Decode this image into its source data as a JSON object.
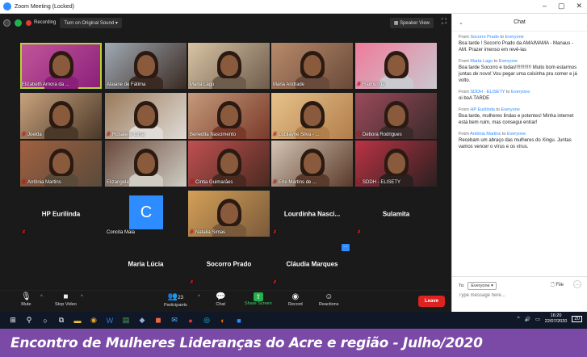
{
  "window": {
    "title": "Zoom Meeting (Locked)",
    "minimize": "–",
    "maximize": "▢",
    "close": "✕"
  },
  "topbar": {
    "recording": "Recording",
    "original_sound": "Turn on Original Sound",
    "original_sound_caret": "▾",
    "speaker_view": "Speaker View",
    "fullscreen": "⛶"
  },
  "tiles": [
    {
      "name": "Elizabeth Amora da ...",
      "muted": false
    },
    {
      "name": "Alaiane de Fátima",
      "muted": false
    },
    {
      "name": "Marta Lago",
      "muted": false
    },
    {
      "name": "Maria Andrade",
      "muted": false
    },
    {
      "name": "Raimunda",
      "muted": true
    },
    {
      "name": "Joelda",
      "muted": true
    },
    {
      "name": "Rosalene Lima",
      "muted": true
    },
    {
      "name": "Benedita Nascimento",
      "muted": false
    },
    {
      "name": "Lucilayne Silva - ...",
      "muted": true
    },
    {
      "name": "Debora Rodrigues",
      "muted": true
    },
    {
      "name": "Antônia Martins",
      "muted": true
    },
    {
      "name": "Elizangela",
      "muted": false
    },
    {
      "name": "Cintia Guimarães",
      "muted": true
    },
    {
      "name": "Erle Martins de ...",
      "muted": true
    },
    {
      "name": "SDDH - ELISETY",
      "muted": true
    },
    {
      "name": "HP Eurilinda",
      "muted": true,
      "text_only": true
    },
    {
      "name": "Concita Maia",
      "muted": false,
      "avatar": "C"
    },
    {
      "name": "Natalia Simas",
      "muted": true
    },
    {
      "name": "Lourdinha Nasci...",
      "muted": true,
      "text_only": true
    },
    {
      "name": "Sulamita",
      "muted": true,
      "text_only": true
    },
    {
      "name": "Maria Lúcia",
      "muted": false,
      "text_only": true
    },
    {
      "name": "Socorro Prado",
      "muted": true,
      "text_only": true
    },
    {
      "name": "Cláudia Marques",
      "muted": true,
      "text_only": true
    }
  ],
  "toolbar": {
    "mute": "Mute",
    "stop_video": "Stop Video",
    "participants": "Participants",
    "participants_count": "23",
    "chat": "Chat",
    "share_screen": "Share Screen",
    "record": "Record",
    "reactions": "Reactions",
    "leave": "Leave"
  },
  "chat": {
    "title": "Chat",
    "messages": [
      {
        "from": "Socorro Prado",
        "to": "Everyone",
        "text": "Boa tarde ! Socorro Prado da AMA/MAMA - Manaus - AM. Prazer imenso em revê-las"
      },
      {
        "from": "Marta Lago",
        "to": "Everyone",
        "text": " Boa tarde Socorro e todas!!!!!!!!!!!! Muito bom estarmos juntas de novo! Vou pegar uma coisinha pra comer e já volto."
      },
      {
        "from": "SDDH - ELISETY",
        "to": "Everyone",
        "text": "oi boA TARDE"
      },
      {
        "from": "HP Eurilinda",
        "to": "Everyone",
        "text": "Boa tarde, mulheres lindas e potentes! Minha internet está bem ruim, mas consegui entrar!"
      },
      {
        "from": "Antônia Martins",
        "to": "Everyone",
        "text": "Recebam um abraço das mulheres do Xingu. Juntas vamos vencer o vírus e os vírus."
      }
    ],
    "from_label": "From",
    "to_word": "to",
    "to_label": "To:",
    "to_value": "Everyone",
    "file": "File",
    "more": "…",
    "placeholder": "Type message here..."
  },
  "taskbar": {
    "time": "16:20",
    "date": "22/07/2020",
    "notifications": "20"
  },
  "banner": {
    "text": "Encontro de Mulheres Lideranças do Acre e região - Julho/2020"
  },
  "colors": {
    "zoom_blue": "#2d8cff",
    "leave_red": "#dd2222",
    "share_green": "#22b14c",
    "banner_purple": "#7b4aa6",
    "active_speaker": "#b8d432"
  }
}
